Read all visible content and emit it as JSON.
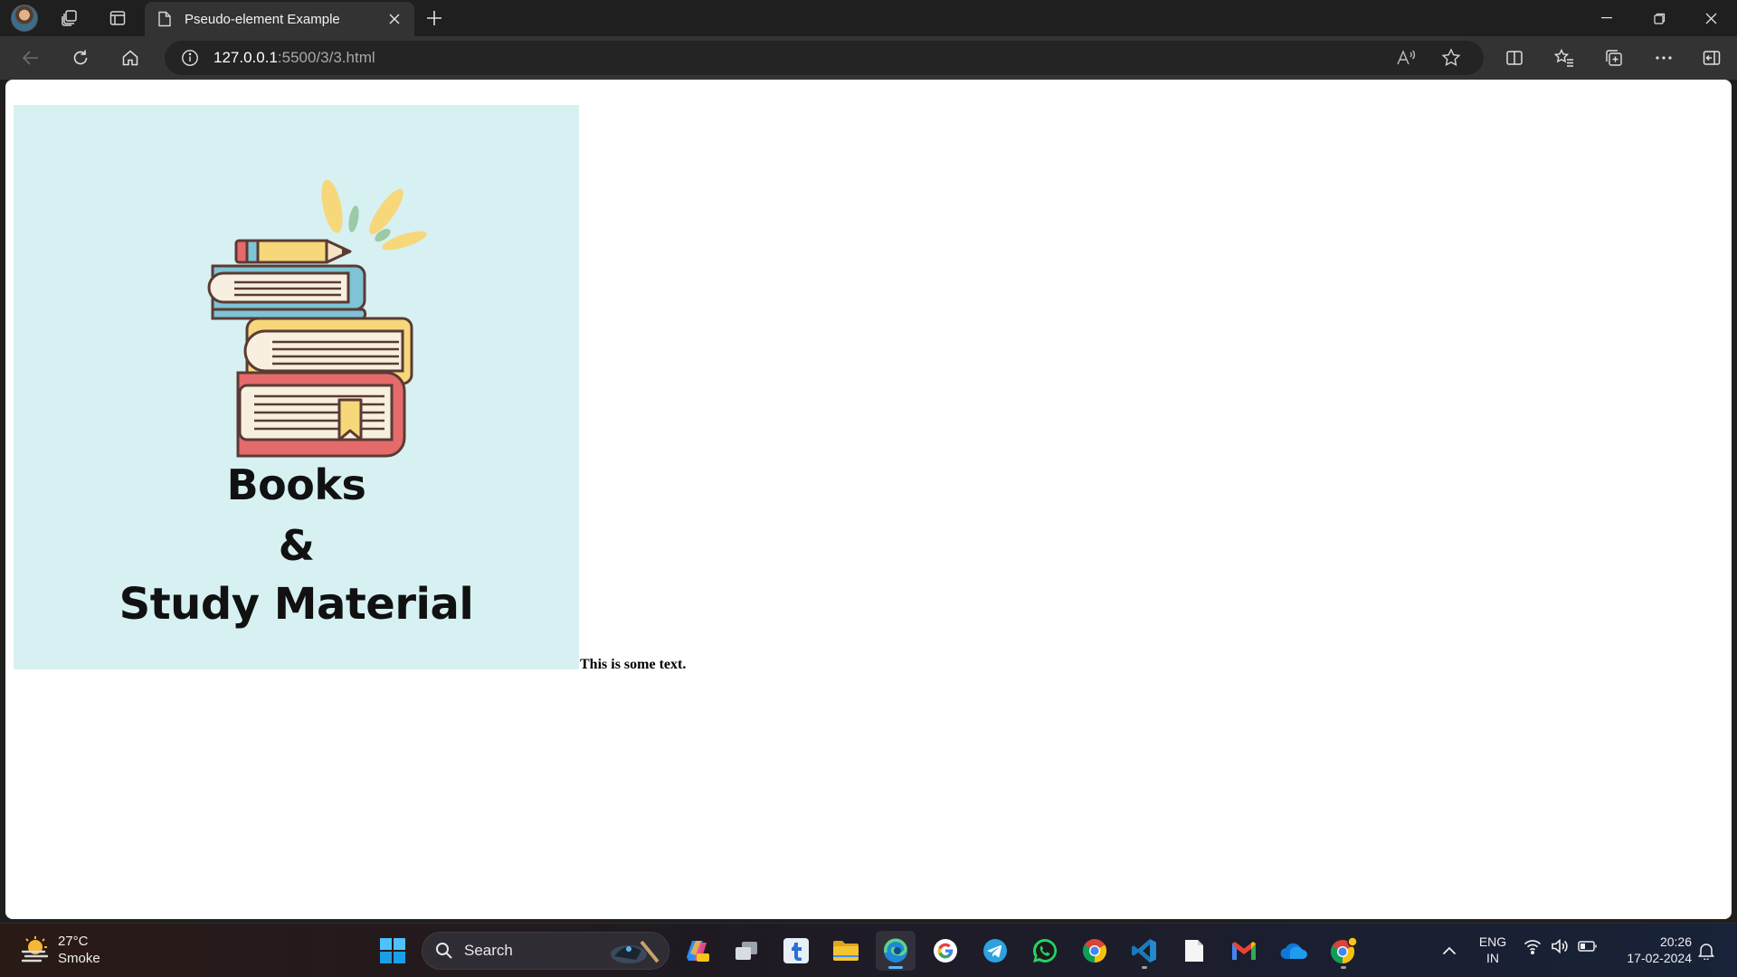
{
  "browser": {
    "tab_title": "Pseudo-element Example",
    "url_host": "127.0.0.1",
    "url_path": ":5500/3/3.html"
  },
  "page": {
    "image_lines": [
      "Books",
      "&",
      "Study Material"
    ],
    "text": "This is some text."
  },
  "taskbar": {
    "weather_temp": "27°C",
    "weather_desc": "Smoke",
    "search_label": "Search",
    "language_line1": "ENG",
    "language_line2": "IN",
    "time": "20:26",
    "date": "17-02-2024"
  },
  "colors": {
    "poster_bg": "#d7f1f2",
    "accent": "#5fb2f2"
  }
}
